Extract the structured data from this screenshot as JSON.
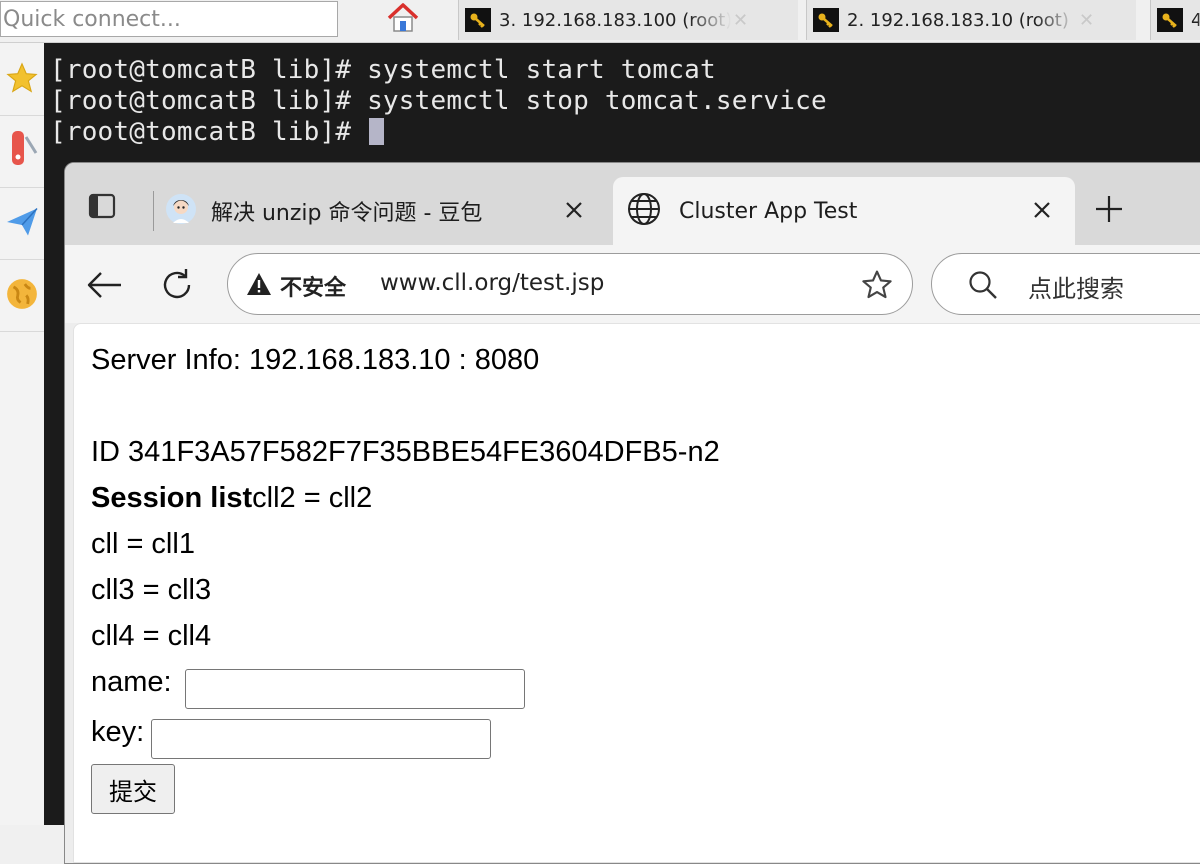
{
  "ssh_client": {
    "quick_connect_placeholder": "Quick connect...",
    "tabs": [
      {
        "label": "3. 192.168.183.100 (root)"
      },
      {
        "label": "2. 192.168.183.10 (root)"
      },
      {
        "label": "4"
      }
    ]
  },
  "terminal": {
    "lines": [
      "[root@tomcatB lib]# systemctl start tomcat",
      "[root@tomcatB lib]# systemctl stop tomcat.service",
      "[root@tomcatB lib]# "
    ]
  },
  "browser": {
    "tabs": [
      {
        "title": "解决 unzip 命令问题 - 豆包"
      },
      {
        "title": "Cluster App Test"
      }
    ],
    "address": {
      "security_label": "不安全",
      "url": "www.cll.org/test.jsp"
    },
    "search_label": "点此搜索"
  },
  "page": {
    "server_info": "Server Info: 192.168.183.10 : 8080",
    "session_id": "ID 341F3A57F582F7F35BBE54FE3604DFB5-n2",
    "session_list_label": "Session list",
    "session_items": [
      "cll2 = cll2",
      "cll = cll1",
      "cll3 = cll3",
      "cll4 = cll4"
    ],
    "form": {
      "name_label": "name:",
      "name_value": "",
      "key_label": "key:",
      "key_value": "",
      "submit_label": "提交"
    }
  }
}
